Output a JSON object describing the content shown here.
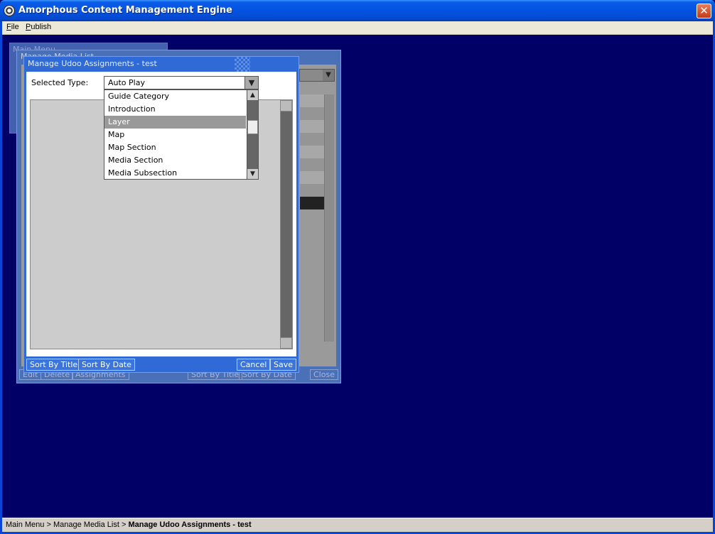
{
  "window": {
    "title": "Amorphous Content Management Engine",
    "close_glyph": "✕"
  },
  "menu": [
    {
      "label": "File"
    },
    {
      "label": "Publish"
    }
  ],
  "background_windows": {
    "main_menu_title": "Main Menu",
    "media_list_title": "Manage Media List",
    "buttons": [
      "Edit",
      "Delete",
      "Assignments",
      "Sort By Title",
      "Sort By Date",
      "Close"
    ]
  },
  "dialog": {
    "title": "Manage Udoo Assignments - test",
    "selected_type_label": "Selected Type:",
    "selected_type_value": "Auto Play",
    "dropdown_options": [
      "Guide Category",
      "Introduction",
      "Layer",
      "Map",
      "Map Section",
      "Media Section",
      "Media Subsection"
    ],
    "highlighted_option": "Layer",
    "buttons": {
      "sort_title": "Sort By Title",
      "sort_date": "Sort By Date",
      "cancel": "Cancel",
      "save": "Save"
    }
  },
  "status": {
    "crumb1": "Main Menu",
    "sep": " > ",
    "crumb2": "Manage Media List",
    "current": "Manage Udoo Assignments - test"
  },
  "icons": {
    "dropdown_arrow": "▼",
    "scroll_up": "▲",
    "scroll_down": "▼"
  },
  "colors": {
    "desktop": "#000066",
    "dialog": "#2f6ad6",
    "titlebar": "#0553e1"
  }
}
